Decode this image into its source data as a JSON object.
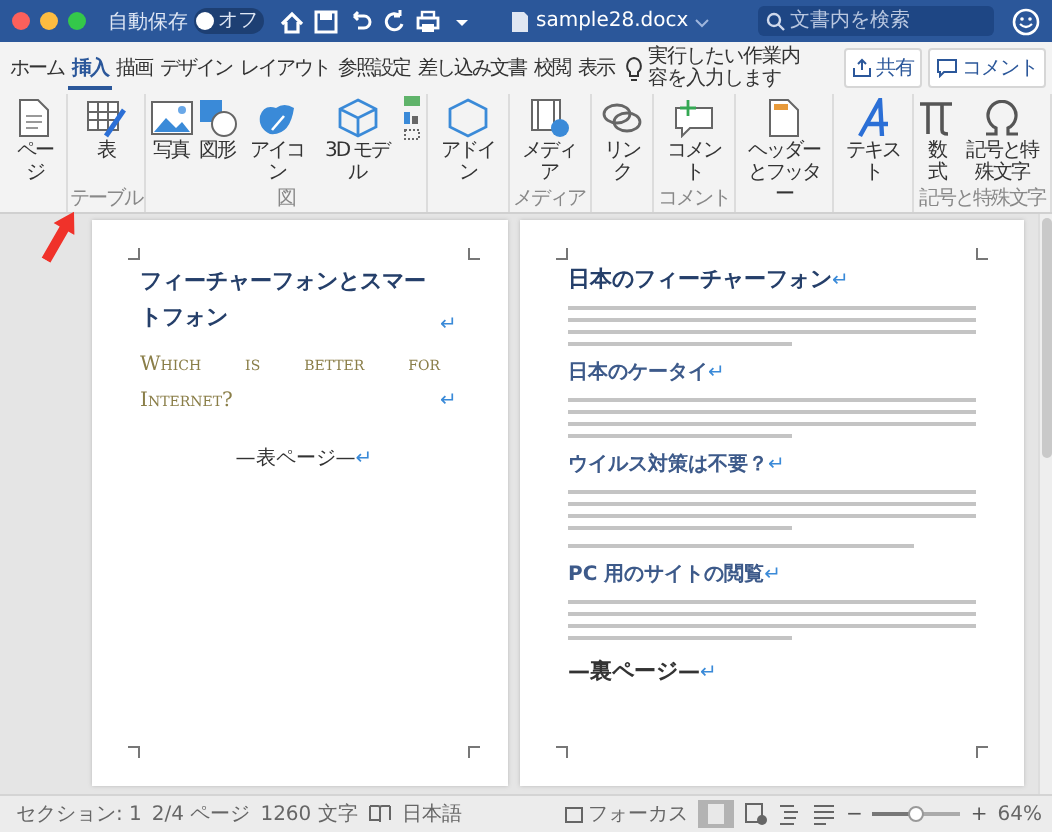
{
  "window": {
    "title": "sample28.docx",
    "autosave_label": "自動保存",
    "autosave_state": "オフ",
    "autosave_on": false,
    "search": {
      "placeholder": "文書内を検索"
    }
  },
  "tabs": [
    {
      "label": "ホーム",
      "selected": false
    },
    {
      "label": "挿入",
      "selected": true
    },
    {
      "label": "描画",
      "selected": false
    },
    {
      "label": "デザイン",
      "selected": false
    },
    {
      "label": "レイアウト",
      "selected": false
    },
    {
      "label": "参照設定",
      "selected": false
    },
    {
      "label": "差し込み文書",
      "selected": false
    },
    {
      "label": "校閲",
      "selected": false
    },
    {
      "label": "表示",
      "selected": false
    }
  ],
  "tell_me": "実行したい作業内容を入力します",
  "share_button": "共有",
  "comment_button": "コメント",
  "ribbon": [
    {
      "items": [
        {
          "kind": "button",
          "label": "ページ"
        }
      ]
    },
    {
      "label": "テーブル",
      "items": [
        {
          "kind": "button",
          "label": "表"
        }
      ]
    },
    {
      "label": "図",
      "items": [
        {
          "kind": "button",
          "label": "写真"
        },
        {
          "kind": "button",
          "label": "図形"
        },
        {
          "kind": "button",
          "label": "アイコン"
        },
        {
          "kind": "button",
          "label": "3D モデル"
        },
        {
          "kind": "stack"
        }
      ]
    },
    {
      "items": [
        {
          "kind": "button",
          "label": "アドイン"
        }
      ]
    },
    {
      "label": "メディア",
      "items": [
        {
          "kind": "button",
          "label": "メディア"
        }
      ]
    },
    {
      "items": [
        {
          "kind": "button",
          "label": "リンク"
        }
      ]
    },
    {
      "label": "コメント",
      "items": [
        {
          "kind": "button",
          "label": "コメント"
        }
      ]
    },
    {
      "items": [
        {
          "kind": "button",
          "label": "ヘッダーとフッター"
        }
      ]
    },
    {
      "items": [
        {
          "kind": "button",
          "label": "テキスト"
        }
      ]
    },
    {
      "label": "記号と特殊文字",
      "items": [
        {
          "kind": "button",
          "label": "数式"
        },
        {
          "kind": "button",
          "label": "記号と特殊文字"
        }
      ]
    }
  ],
  "pages": [
    {
      "blocks": [
        {
          "kind": "title",
          "text": "フィーチャーフォンとスマートフォン",
          "mark": "↵"
        },
        {
          "kind": "subtitle",
          "text": "Which is better for Internet?",
          "mark": "↵"
        },
        {
          "kind": "pagebreak",
          "text": "—表ページ—",
          "mark": "↵"
        }
      ]
    },
    {
      "blocks": [
        {
          "kind": "heading",
          "text": "日本のフィーチャーフォン",
          "mark": "↵"
        },
        {
          "kind": "paragraph"
        },
        {
          "kind": "heading",
          "text": "日本のケータイ",
          "mark": "↵"
        },
        {
          "kind": "paragraph"
        },
        {
          "kind": "heading",
          "text": "ウイルス対策は不要？",
          "mark": "↵"
        },
        {
          "kind": "paragraph"
        },
        {
          "kind": "line"
        },
        {
          "kind": "heading",
          "text": "PC 用のサイトの閲覧",
          "mark": "↵"
        },
        {
          "kind": "paragraph"
        },
        {
          "kind": "pagebreak",
          "text": "—裏ページ—",
          "mark": "↵"
        }
      ]
    }
  ],
  "status_bar": {
    "section": "セクション: 1",
    "page": "2/4 ページ",
    "words": "1260 文字",
    "language": "日本語",
    "focus": "フォーカス",
    "zoom_out": "−",
    "zoom_slider": {
      "level": 0.5
    },
    "zoom_in": "+",
    "zoom": "64%"
  }
}
